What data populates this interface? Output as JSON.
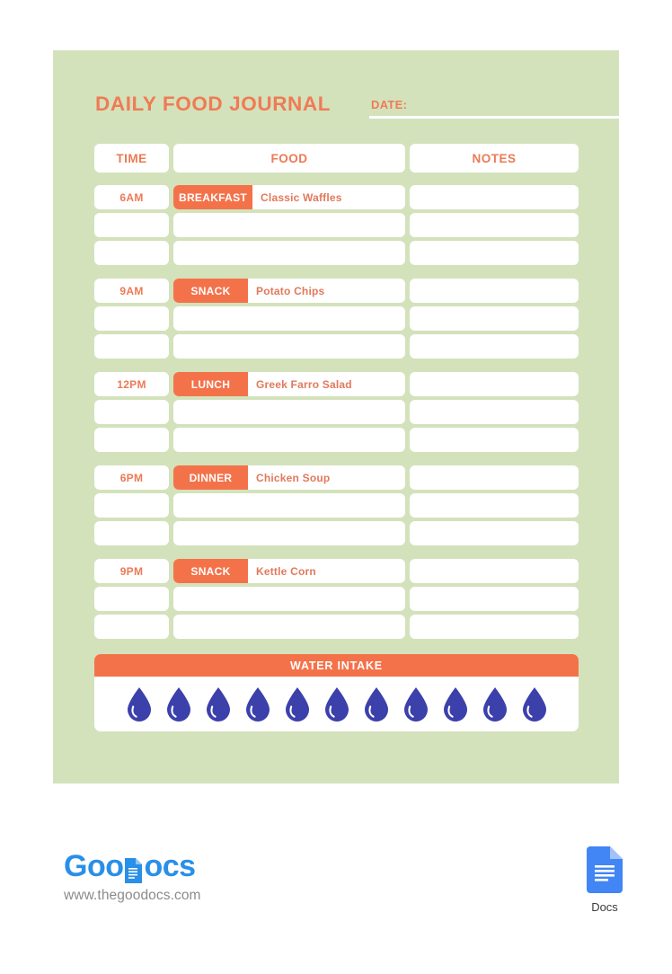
{
  "document": {
    "title": "DAILY FOOD JOURNAL",
    "date_label": "DATE:",
    "date_value": ""
  },
  "colors": {
    "panel_bg": "#d3e2bb",
    "accent_orange": "#f4724a",
    "title_orange": "#ef7b55",
    "text_coral": "#e2795c",
    "cell_white": "#ffffff",
    "water_drop_blue": "#3b40ab",
    "logo_blue": "#2a8fe8",
    "url_gray": "#8b8b8b"
  },
  "table": {
    "columns": [
      "TIME",
      "FOOD",
      "NOTES"
    ],
    "rows": [
      {
        "time": "6AM",
        "meal": "BREAKFAST",
        "food": "Classic Waffles",
        "notes": "",
        "extra_rows": 2
      },
      {
        "time": "9AM",
        "meal": "SNACK",
        "food": "Potato Chips",
        "notes": "",
        "extra_rows": 2
      },
      {
        "time": "12PM",
        "meal": "LUNCH",
        "food": "Greek Farro Salad",
        "notes": "",
        "extra_rows": 2
      },
      {
        "time": "6PM",
        "meal": "DINNER",
        "food": "Chicken Soup",
        "notes": "",
        "extra_rows": 2
      },
      {
        "time": "9PM",
        "meal": "SNACK",
        "food": "Kettle Corn",
        "notes": "",
        "extra_rows": 2
      }
    ]
  },
  "water_intake": {
    "title": "WATER INTAKE",
    "drop_count": 11,
    "drops_filled": 0
  },
  "footer": {
    "logo_text_before": "Goo",
    "logo_text_after": "ocs",
    "logo_icon": "document-glyph-icon",
    "url": "www.thegoodocs.com",
    "badge_label": "Docs",
    "badge_icon": "google-docs-icon"
  }
}
